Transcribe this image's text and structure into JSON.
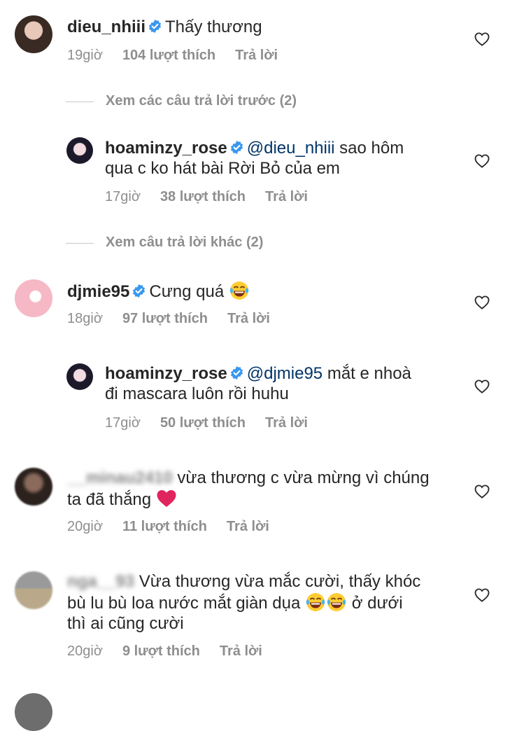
{
  "comments": [
    {
      "username": "dieu_nhiii",
      "text": "Thấy thương",
      "time": "19giờ",
      "likes": "104 lượt thích",
      "reply": "Trả lời"
    },
    {
      "username": "hoaminzy_rose",
      "mention": "@dieu_nhiii",
      "text_l1": " sao hôm",
      "text_l2": "qua c ko hát bài Rời Bỏ của em",
      "time": "17giờ",
      "likes": "38 lượt thích",
      "reply": "Trả lời"
    },
    {
      "username": "djmie95",
      "text": "Cưng quá",
      "time": "18giờ",
      "likes": "97 lượt thích",
      "reply": "Trả lời"
    },
    {
      "username": "hoaminzy_rose",
      "mention": "@djmie95",
      "text_l1": " mắt e nhoà",
      "text_l2": "đi mascara luôn rồi huhu",
      "time": "17giờ",
      "likes": "50 lượt thích",
      "reply": "Trả lời"
    },
    {
      "username": "__minau2410",
      "text_l1": " vừa thương c vừa mừng vì chúng",
      "text_l2": "ta đã thắng",
      "time": "20giờ",
      "likes": "11 lượt thích",
      "reply": "Trả lời"
    },
    {
      "username": "nga__93",
      "text_l1": " Vừa thương vừa mắc cười, thấy khóc",
      "text_l2": "bù lu bù loa nước mắt giàn dụa",
      "text_l2b": " ở dưới",
      "text_l3": "thì  ai cũng cười",
      "time": "20giờ",
      "likes": "9 lượt thích",
      "reply": "Trả lời"
    }
  ],
  "toggles": {
    "prev_replies": "Xem các câu trả lời trước (2)",
    "more_replies": "Xem câu trả lời khác (2)"
  },
  "icons": {
    "verified": "verified-badge-icon",
    "like": "heart-outline-icon",
    "emoji_laugh": "tears-of-joy-emoji",
    "emoji_heart": "red-heart-emoji"
  },
  "colors": {
    "verified": "#3897f0",
    "meta": "#8e8e8e",
    "text": "#262626",
    "heart_red": "#e0245e"
  }
}
